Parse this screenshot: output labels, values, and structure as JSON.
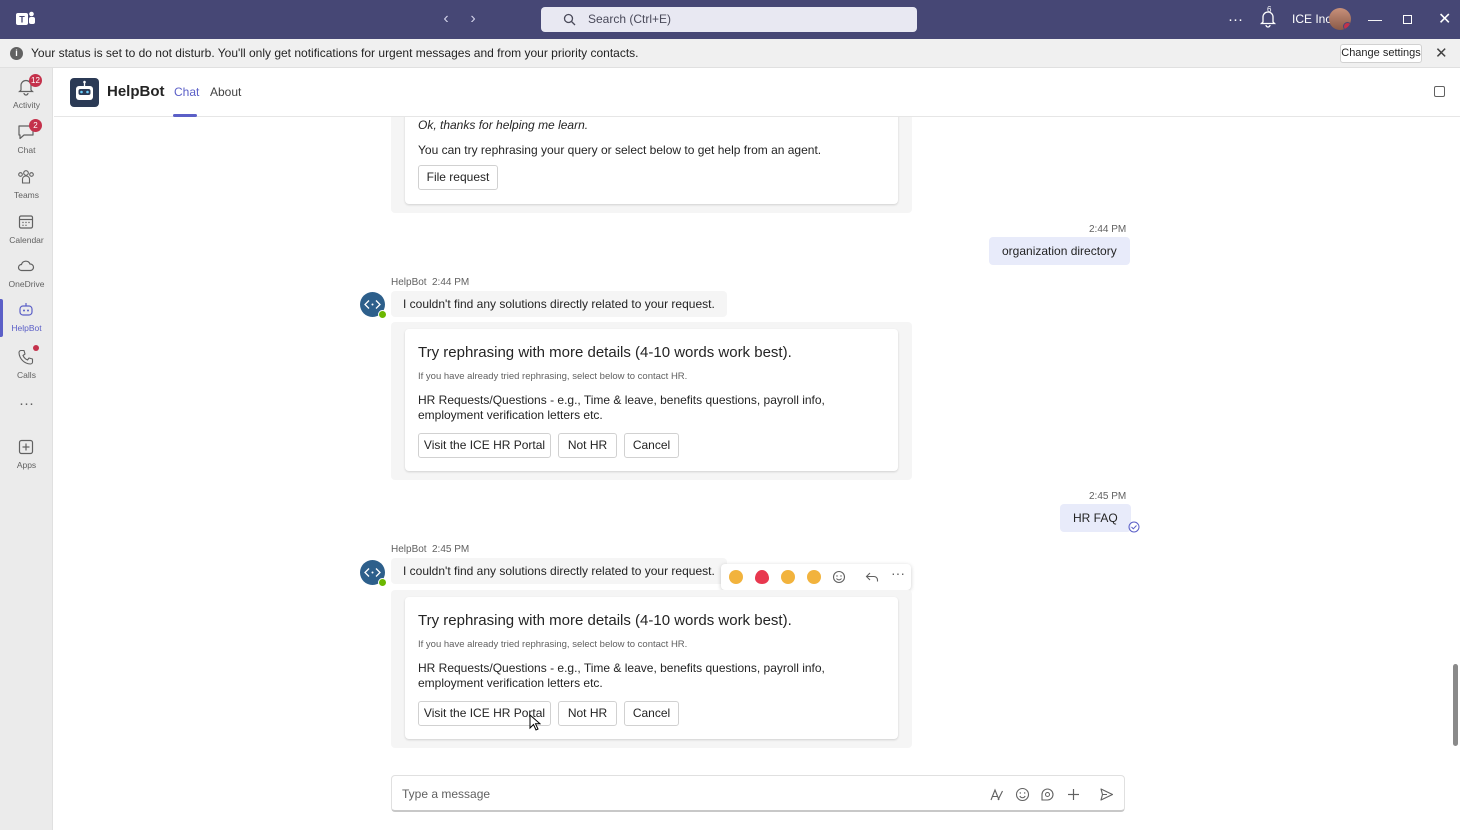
{
  "titlebar": {
    "search_placeholder": "Search (Ctrl+E)",
    "org_name": "ICE Inc.",
    "notif_count": "6"
  },
  "banner": {
    "message": "Your status is set to do not disturb. You'll only get notifications for urgent messages and from your priority contacts.",
    "change_settings": "Change settings"
  },
  "rail": {
    "items": [
      {
        "label": "Activity",
        "badge": "12"
      },
      {
        "label": "Chat",
        "badge": "2"
      },
      {
        "label": "Teams"
      },
      {
        "label": "Calendar"
      },
      {
        "label": "OneDrive"
      },
      {
        "label": "HelpBot"
      },
      {
        "label": "Calls"
      },
      {
        "label": "Apps"
      }
    ]
  },
  "header": {
    "bot_name": "HelpBot",
    "tabs": [
      "Chat",
      "About"
    ]
  },
  "chat": {
    "top_card": {
      "thanks": "Ok, thanks for helping me learn.",
      "hint": "You can try rephrasing your query or select below to get help from an agent.",
      "button": "File request"
    },
    "msg1": {
      "time": "2:44 PM",
      "text": "organization directory"
    },
    "bot1": {
      "sender": "HelpBot",
      "time": "2:44 PM",
      "text": "I couldn't find any solutions directly related to your request.",
      "card_title": "Try rephrasing with more details (4-10 words work best).",
      "card_sub": "If you have already tried rephrasing, select below to contact HR.",
      "card_bold": "HR Requests/Questions",
      "card_body": " - e.g., Time & leave, benefits questions, payroll info, employment verification letters etc.",
      "buttons": [
        "Visit the ICE HR Portal",
        "Not HR",
        "Cancel"
      ]
    },
    "msg2": {
      "time": "2:45 PM",
      "text": "HR FAQ"
    },
    "bot2": {
      "sender": "HelpBot",
      "time": "2:45 PM",
      "text": "I couldn't find any solutions directly related to your request.",
      "card_title": "Try rephrasing with more details (4-10 words work best).",
      "card_sub": "If you have already tried rephrasing, select below to contact HR.",
      "card_bold": "HR Requests/Questions",
      "card_body": " - e.g., Time & leave, benefits questions, payroll info, employment verification letters etc.",
      "buttons": [
        "Visit the ICE HR Portal",
        "Not HR",
        "Cancel"
      ]
    }
  },
  "compose": {
    "placeholder": "Type a message"
  },
  "colors": {
    "titlebar": "#464775",
    "accent": "#5b5fc7",
    "badge": "#c4314b"
  }
}
